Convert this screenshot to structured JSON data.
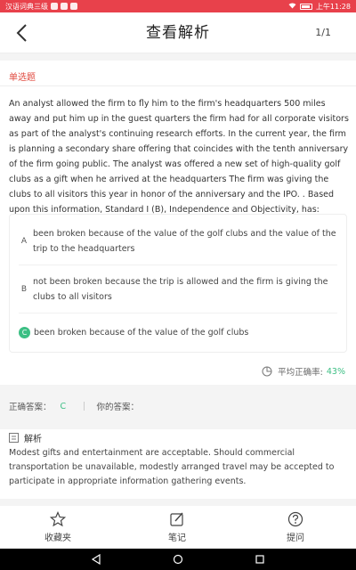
{
  "status_bar": {
    "app_text": "汉语词典三级",
    "time": "上午11:28"
  },
  "nav": {
    "title": "查看解析",
    "page_counter": "1/1"
  },
  "question": {
    "type": "单选题",
    "text": "An analyst allowed the firm to fly him to the firm's headquarters 500 miles away and put him up in the guest quarters the firm had for all corporate visitors as part of the analyst's continuing research efforts. In the current year, the firm is planning a secondary share offering that coincides with the tenth anniversary of the firm going public. The analyst was offered a new set of high-quality golf clubs as a gift when he arrived at the headquarters The firm was giving the clubs to all visitors this year in honor of the anniversary and the IPO. . Based upon this information, Standard I (B), Independence and Objectivity, has:"
  },
  "options": [
    {
      "letter": "A",
      "text": "been broken because of the value of the golf clubs and the value of the trip to the headquarters",
      "correct": false
    },
    {
      "letter": "B",
      "text": "not been broken because the trip is allowed and the firm is giving the clubs to all visitors",
      "correct": false
    },
    {
      "letter": "C",
      "text": "been broken because of the value of the golf clubs",
      "correct": true
    }
  ],
  "accuracy": {
    "label": "平均正确率:",
    "value": "43%"
  },
  "answers": {
    "correct_label": "正确答案：",
    "correct_value": "C",
    "yours_label": "你的答案：",
    "yours_value": ""
  },
  "analysis": {
    "title": "解析",
    "text": "Modest gifts and entertainment are acceptable. Should commercial transportation be unavailable, modestly arranged travel may be accepted to participate in appropriate information gathering events."
  },
  "toolbar": {
    "favorite_label": "收藏夹",
    "notes_label": "笔记",
    "ask_label": "提问"
  },
  "colors": {
    "status_bar": "#e8414b",
    "question_type": "#e04a3f",
    "correct": "#3cbf84"
  },
  "icons": [
    "back-arrow-icon",
    "accuracy-chart-icon",
    "analysis-icon",
    "star-icon",
    "edit-note-icon",
    "question-circle-icon",
    "nav-back-icon",
    "nav-home-icon",
    "nav-recents-icon"
  ]
}
